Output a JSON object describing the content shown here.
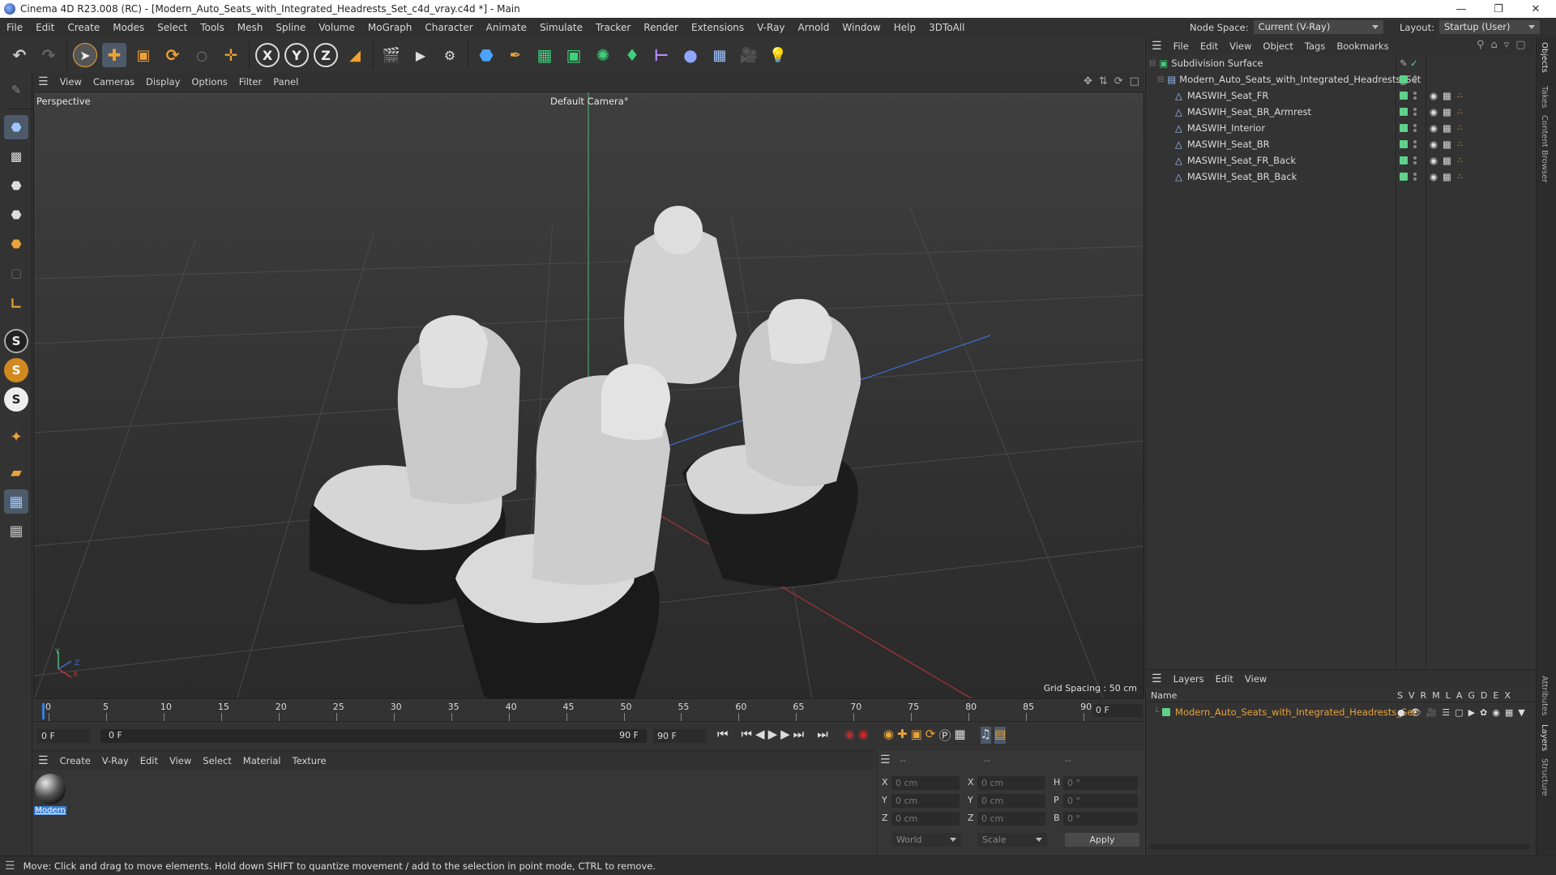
{
  "window": {
    "title": "Cinema 4D R23.008 (RC) - [Modern_Auto_Seats_with_Integrated_Headrests_Set_c4d_vray.c4d *] - Main",
    "controls": [
      "minimize-icon",
      "maximize-icon",
      "close-icon"
    ]
  },
  "menubar": {
    "items": [
      "File",
      "Edit",
      "Create",
      "Modes",
      "Select",
      "Tools",
      "Mesh",
      "Spline",
      "Volume",
      "MoGraph",
      "Character",
      "Animate",
      "Simulate",
      "Tracker",
      "Render",
      "Extensions",
      "V-Ray",
      "Arnold",
      "Window",
      "Help",
      "3DToAll"
    ],
    "node_space_label": "Node Space:",
    "node_space_value": "Current (V-Ray)",
    "layout_label": "Layout:",
    "layout_value": "Startup (User)"
  },
  "viewport": {
    "menu": [
      "View",
      "Cameras",
      "Display",
      "Options",
      "Filter",
      "Panel"
    ],
    "label": "Perspective",
    "camera": "Default Camera",
    "camera_suffix": "°",
    "grid_spacing": "Grid Spacing : 50 cm",
    "axis": {
      "y": "Y",
      "z": "Z",
      "x": "X"
    }
  },
  "timeline": {
    "ticks": [
      "0",
      "5",
      "10",
      "15",
      "20",
      "25",
      "30",
      "35",
      "40",
      "45",
      "50",
      "55",
      "60",
      "65",
      "70",
      "75",
      "80",
      "85",
      "90"
    ],
    "current_frame": "0 F"
  },
  "transport": {
    "start_frame": "0 F",
    "range_start": "0 F",
    "range_end": "90 F",
    "end_frame": "90 F"
  },
  "material_manager": {
    "menu": [
      "Create",
      "V-Ray",
      "Edit",
      "View",
      "Select",
      "Material",
      "Texture"
    ],
    "material_name": "Modern"
  },
  "coordinates": {
    "header": [
      "--",
      "--",
      "--"
    ],
    "rows": [
      {
        "a": "X",
        "av": "0 cm",
        "b": "X",
        "bv": "0 cm",
        "c": "H",
        "cv": "0 °"
      },
      {
        "a": "Y",
        "av": "0 cm",
        "b": "Y",
        "bv": "0 cm",
        "c": "P",
        "cv": "0 °"
      },
      {
        "a": "Z",
        "av": "0 cm",
        "b": "Z",
        "bv": "0 cm",
        "c": "B",
        "cv": "0 °"
      }
    ],
    "mode": "World",
    "type": "Scale",
    "apply": "Apply"
  },
  "object_manager": {
    "menu": [
      "File",
      "Edit",
      "View",
      "Object",
      "Tags",
      "Bookmarks"
    ],
    "objects": [
      {
        "name": "Subdivision Surface",
        "level": 0
      },
      {
        "name": "Modern_Auto_Seats_with_Integrated_Headrests_Set",
        "level": 1
      },
      {
        "name": "MASWIH_Seat_FR",
        "level": 2
      },
      {
        "name": "MASWIH_Seat_BR_Armrest",
        "level": 2
      },
      {
        "name": "MASWIH_Interior",
        "level": 2
      },
      {
        "name": "MASWIH_Seat_BR",
        "level": 2
      },
      {
        "name": "MASWIH_Seat_FR_Back",
        "level": 2
      },
      {
        "name": "MASWIH_Seat_BR_Back",
        "level": 2
      }
    ]
  },
  "layers": {
    "menu": [
      "Layers",
      "Edit",
      "View"
    ],
    "name_header": "Name",
    "columns": [
      "S",
      "V",
      "R",
      "M",
      "L",
      "A",
      "G",
      "D",
      "E",
      "X"
    ],
    "layer_name": "Modern_Auto_Seats_with_Integrated_Headrests_Set",
    "layer_color": "#e8a33a"
  },
  "side_tabs": [
    "Objects",
    "Takes",
    "Content Browser",
    "Attributes",
    "Layers",
    "Structure"
  ],
  "status": "Move: Click and drag to move elements. Hold down SHIFT to quantize movement / add to the selection in point mode, CTRL to remove.",
  "colors": {
    "accent_orange": "#e8a33a",
    "selection_blue": "#3b7fd4",
    "green_check": "#5fd18a"
  }
}
